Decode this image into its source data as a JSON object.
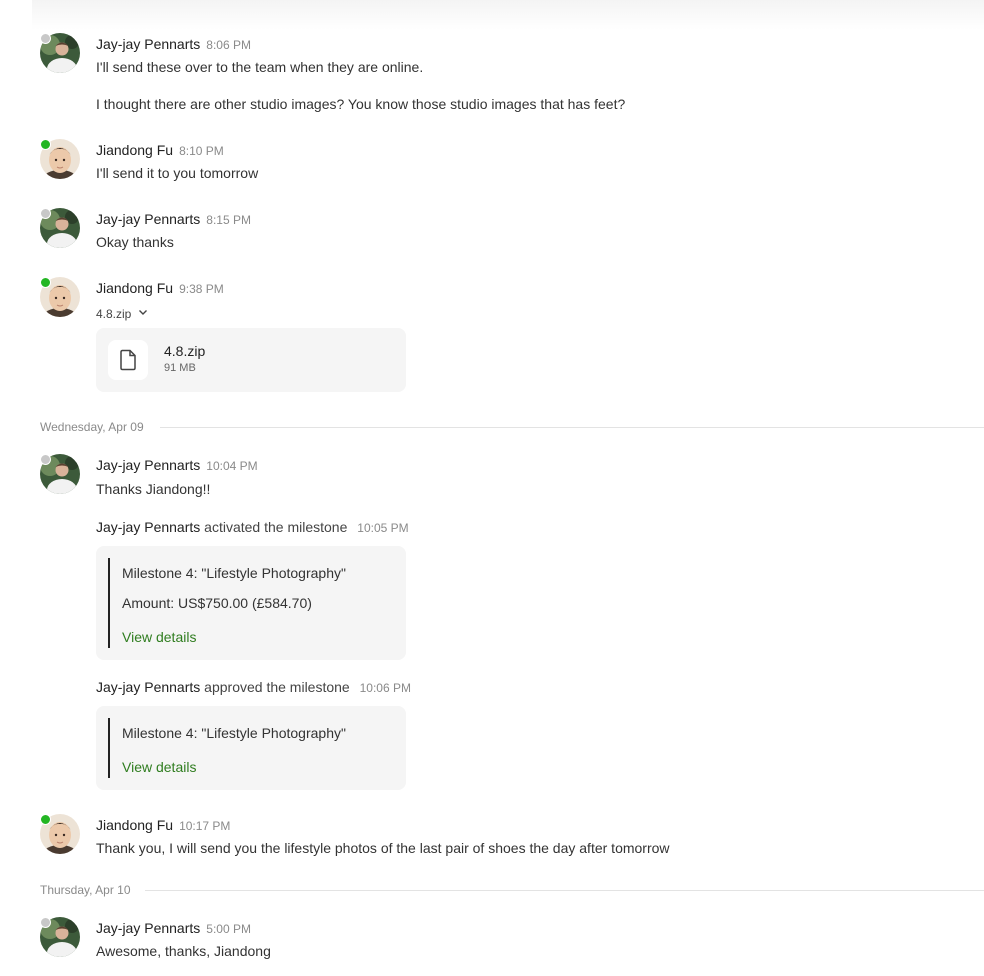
{
  "messages": [
    {
      "name": "Jay-jay Pennarts",
      "time": "8:06 PM",
      "lines": [
        "I'll send these over to the team when they are online.",
        "I thought there are other studio images? You know those studio images that has feet?"
      ]
    },
    {
      "name": "Jiandong Fu",
      "time": "8:10 PM",
      "lines": [
        "I'll send it to you tomorrow"
      ]
    },
    {
      "name": "Jay-jay Pennarts",
      "time": "8:15 PM",
      "lines": [
        "Okay thanks"
      ]
    },
    {
      "name": "Jiandong Fu",
      "time": "9:38 PM",
      "attachment_toggle": "4.8.zip",
      "file": {
        "name": "4.8.zip",
        "size": "91 MB",
        "icon": "file-icon"
      }
    },
    {
      "name": "Jay-jay Pennarts",
      "time": "10:04 PM",
      "lines": [
        "Thanks Jiandong!!"
      ]
    },
    {
      "name": "Jiandong Fu",
      "time": "10:17 PM",
      "lines": [
        "Thank you, I will send you the lifestyle photos of the last pair of shoes the day after tomorrow"
      ]
    },
    {
      "name": "Jay-jay Pennarts",
      "time": "5:00 PM",
      "lines": [
        "Awesome, thanks, Jiandong"
      ]
    }
  ],
  "dividers": [
    "Wednesday, Apr 09",
    "Thursday, Apr 10"
  ],
  "milestone_events": [
    {
      "actor": "Jay-jay Pennarts",
      "action": "activated the milestone",
      "time": "10:05 PM",
      "title": "Milestone 4: \"Lifestyle Photography\"",
      "amount": "Amount: US$750.00 (£584.70)",
      "link": "View details"
    },
    {
      "actor": "Jay-jay Pennarts",
      "action": "approved the milestone",
      "time": "10:06 PM",
      "title": "Milestone 4: \"Lifestyle Photography\"",
      "link": "View details"
    }
  ],
  "colors": {
    "online": "#23b623",
    "offline": "#c8c8c8",
    "link": "#2f7d1f",
    "divider": "#e3e3e3"
  }
}
